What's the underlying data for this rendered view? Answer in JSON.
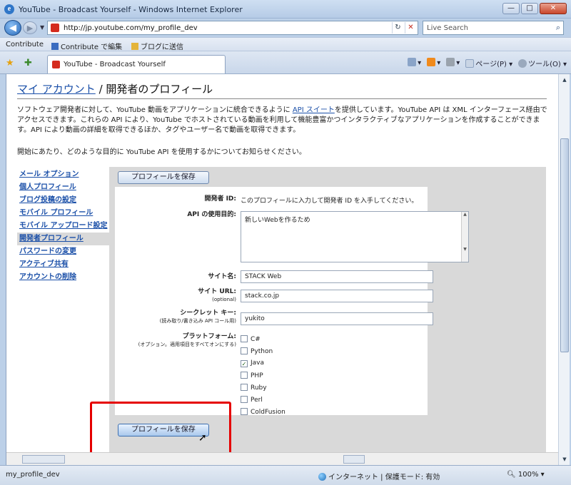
{
  "window": {
    "title": "YouTube - Broadcast Yourself - Windows Internet Explorer",
    "controls": {
      "minimize": "—",
      "maximize": "□",
      "close": "✕"
    }
  },
  "navbar": {
    "url": "http://jp.youtube.com/my_profile_dev",
    "search_placeholder": "Live Search",
    "refresh": "↻",
    "stop": "✕"
  },
  "linksbar": {
    "items": [
      "Contribute",
      "Contribute で編集",
      "ブログに送信"
    ]
  },
  "tab": {
    "label": "YouTube - Broadcast Yourself"
  },
  "commandbar": {
    "page": "ページ(P)",
    "tools": "ツール(O)"
  },
  "page": {
    "breadcrumb_link": "マイ アカウント",
    "breadcrumb_sep": "/",
    "heading": "開発者のプロフィール",
    "intro_before_link": "ソフトウェア開発者に対して、YouTube 動画をアプリケーションに統合できるように ",
    "intro_link": "API スイート",
    "intro_after_link": "を提供しています。YouTube API は XML インターフェース経由でアクセスできます。これらの API により、YouTube でホストされている動画を利用して機能豊富かつインタラクティブなアプリケーションを作成することができます。API により動画の詳細を取得できるほか、タグやユーザー名で動画を取得できます。",
    "intro2": "開始にあたり、どのような目的に YouTube API を使用するかについてお知らせください。"
  },
  "sidebar": {
    "items": [
      {
        "label": "メール オプション",
        "active": false
      },
      {
        "label": "個人プロフィール",
        "active": false
      },
      {
        "label": "ブログ投稿の設定",
        "active": false
      },
      {
        "label": "モバイル プロフィール",
        "active": false
      },
      {
        "label": "モバイル アップロード設定",
        "active": false
      },
      {
        "label": "開発者プロフィール",
        "active": true
      },
      {
        "label": "パスワードの変更",
        "active": false
      },
      {
        "label": "アクティブ共有",
        "active": false
      },
      {
        "label": "アカウントの削除",
        "active": false
      }
    ]
  },
  "form": {
    "save_label": "プロフィールを保存",
    "developer_id_label": "開発者 ID:",
    "developer_id_text": "このプロフィールに入力して開発者 ID を入手してください。",
    "api_purpose_label": "API の使用目的:",
    "api_purpose_value": "新しいWebを作るため",
    "site_name_label": "サイト名:",
    "site_name_value": "STACK Web",
    "site_url_label": "サイト URL:",
    "site_url_sub": "(optional)",
    "site_url_value": "stack.co.jp",
    "secret_key_label": "シークレット キー:",
    "secret_key_sub": "(読み取り/書き込み API コール用)",
    "secret_key_value": "yukito",
    "platform_label": "プラットフォーム:",
    "platform_sub": "(オプション。適用項目をすべてオンにする)",
    "platforms": [
      {
        "label": "C#",
        "checked": false
      },
      {
        "label": "Python",
        "checked": false
      },
      {
        "label": "Java",
        "checked": true
      },
      {
        "label": "PHP",
        "checked": false
      },
      {
        "label": "Ruby",
        "checked": false
      },
      {
        "label": "Perl",
        "checked": false
      },
      {
        "label": "ColdFusion",
        "checked": false
      }
    ]
  },
  "statusbar": {
    "left": "my_profile_dev",
    "zone": "インターネット | 保護モード: 有効",
    "zoom": "100%"
  },
  "colors": {
    "link": "#1a4fa8",
    "highlight": "#e50000",
    "panel": "#d9d9d9"
  }
}
